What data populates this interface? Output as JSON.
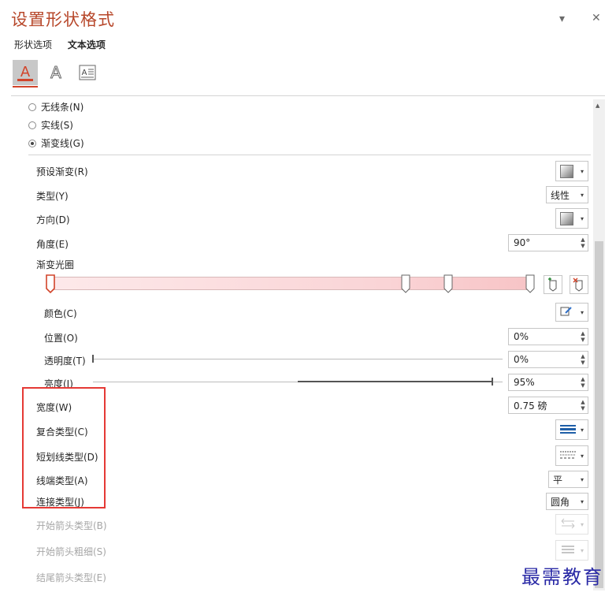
{
  "pane": {
    "title": "设置形状格式"
  },
  "tabs": {
    "shape_options": "形状选项",
    "text_options": "文本选项"
  },
  "line": {
    "no_line": "无线条(N)",
    "solid_line": "实线(S)",
    "gradient_line": "渐变线(G)",
    "selected": "gradient_line"
  },
  "fields": {
    "preset_gradient": "预设渐变(R)",
    "type": "类型(Y)",
    "type_value": "线性",
    "direction": "方向(D)",
    "angle": "角度(E)",
    "angle_value": "90°",
    "gradient_stops": "渐变光圈",
    "color": "颜色(C)",
    "position": "位置(O)",
    "position_value": "0%",
    "transparency": "透明度(T)",
    "transparency_value": "0%",
    "brightness": "亮度(I)",
    "brightness_value": "95%",
    "width": "宽度(W)",
    "width_value": "0.75 磅",
    "compound_type": "复合类型(C)",
    "dash_type": "短划线类型(D)",
    "cap_type": "线端类型(A)",
    "cap_value": "平",
    "join_type": "连接类型(J)",
    "join_value": "圆角",
    "begin_arrow_type": "开始箭头类型(B)",
    "begin_arrow_size": "开始箭头粗细(S)",
    "end_arrow_type": "结尾箭头类型(E)"
  },
  "gradient": {
    "stops": [
      0,
      74,
      83,
      100
    ],
    "selected_stop": 0,
    "colors": {
      "start": "#fde9ea",
      "end": "#f7c4c6"
    }
  },
  "sliders": {
    "transparency": 0,
    "brightness": 95
  },
  "icons": {
    "close": "✕",
    "dropdown": "▾",
    "fill_line": "A",
    "text_effects": "A",
    "text_box": "A≡"
  },
  "watermark": "最需教育",
  "colors": {
    "accent": "#b7472a",
    "highlight": "#e53935"
  }
}
